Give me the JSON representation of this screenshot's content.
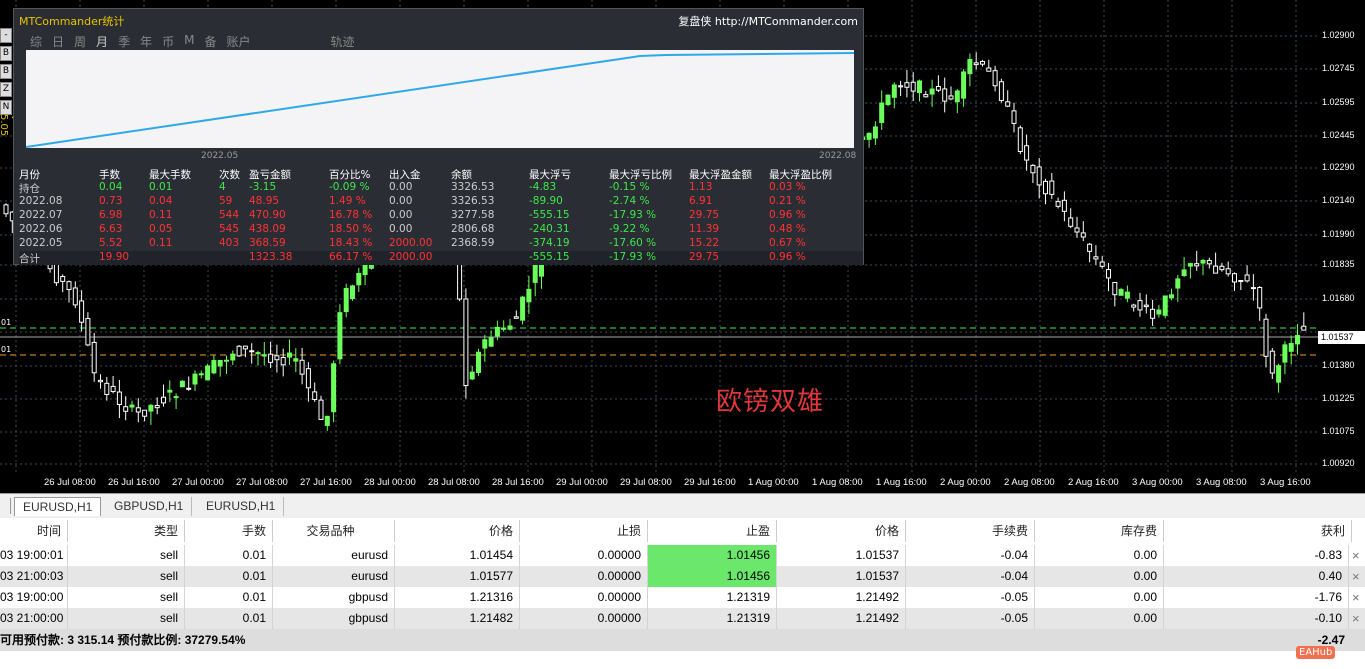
{
  "left_tools": [
    "-",
    "B",
    "B",
    "Z",
    "N"
  ],
  "version_label": "V 5.05",
  "left_levels": [
    "01",
    "01"
  ],
  "price_axis": {
    "labels": [
      "1.02900",
      "1.02745",
      "1.02595",
      "1.02445",
      "1.02290",
      "1.02140",
      "1.01990",
      "1.01835",
      "1.01680",
      "1.01380",
      "1.01225",
      "1.01075",
      "1.00920"
    ],
    "current": "1.01537"
  },
  "time_axis": [
    "26 Jul 08:00",
    "26 Jul 16:00",
    "27 Jul 00:00",
    "27 Jul 08:00",
    "27 Jul 16:00",
    "28 Jul 00:00",
    "28 Jul 08:00",
    "28 Jul 16:00",
    "29 Jul 00:00",
    "29 Jul 08:00",
    "29 Jul 16:00",
    "1 Aug 00:00",
    "1 Aug 08:00",
    "1 Aug 16:00",
    "2 Aug 00:00",
    "2 Aug 08:00",
    "2 Aug 16:00",
    "3 Aug 00:00",
    "3 Aug 08:00",
    "3 Aug 16:00"
  ],
  "watermark": "欧镑双雄",
  "stats": {
    "title": "MTCommander统计",
    "link": "复盘侠 http://MTCommander.com",
    "tabs": [
      "综",
      "日",
      "周",
      "月",
      "季",
      "年",
      "币",
      "M",
      "备",
      "账户",
      "轨迹"
    ],
    "active_tab": "月",
    "chart_start": "2022.05",
    "chart_end": "2022.08",
    "headers": [
      "月份",
      "手数",
      "最大手数",
      "次数",
      "盈亏金额",
      "百分比%",
      "出入金",
      "余额",
      "最大浮亏",
      "最大浮亏比例",
      "最大浮盈金额",
      "最大浮盈比例"
    ],
    "rows": [
      {
        "label": "持仓",
        "lots": "0.04",
        "max_lots": "0.01",
        "count": "4",
        "pnl": "-3.15",
        "pct": "-0.09 %",
        "io": "0.00",
        "balance": "3326.53",
        "max_dd": "-4.83",
        "max_dd_pct": "-0.15 %",
        "max_fp": "1.13",
        "max_fp_pct": "0.03 %"
      },
      {
        "label": "2022.08",
        "lots": "0.73",
        "max_lots": "0.04",
        "count": "59",
        "pnl": "48.95",
        "pct": "1.49 %",
        "io": "0.00",
        "balance": "3326.53",
        "max_dd": "-89.90",
        "max_dd_pct": "-2.74 %",
        "max_fp": "6.91",
        "max_fp_pct": "0.21 %"
      },
      {
        "label": "2022.07",
        "lots": "6.98",
        "max_lots": "0.11",
        "count": "544",
        "pnl": "470.90",
        "pct": "16.78 %",
        "io": "0.00",
        "balance": "3277.58",
        "max_dd": "-555.15",
        "max_dd_pct": "-17.93 %",
        "max_fp": "29.75",
        "max_fp_pct": "0.96 %"
      },
      {
        "label": "2022.06",
        "lots": "6.63",
        "max_lots": "0.05",
        "count": "545",
        "pnl": "438.09",
        "pct": "18.50 %",
        "io": "0.00",
        "balance": "2806.68",
        "max_dd": "-240.31",
        "max_dd_pct": "-9.22 %",
        "max_fp": "11.39",
        "max_fp_pct": "0.48 %"
      },
      {
        "label": "2022.05",
        "lots": "5.52",
        "max_lots": "0.11",
        "count": "403",
        "pnl": "368.59",
        "pct": "18.43 %",
        "io": "2000.00",
        "balance": "2368.59",
        "max_dd": "-374.19",
        "max_dd_pct": "-17.60 %",
        "max_fp": "15.22",
        "max_fp_pct": "0.67 %"
      }
    ],
    "total": {
      "label": "合计",
      "lots": "19.90",
      "max_lots": "",
      "count": "",
      "pnl": "1323.38",
      "pct": "66.17 %",
      "io": "2000.00",
      "balance": "",
      "max_dd": "-555.15",
      "max_dd_pct": "-17.93 %",
      "max_fp": "29.75",
      "max_fp_pct": "0.96 %"
    }
  },
  "chart_tabs": [
    "EURUSD,H1",
    "GBPUSD,H1",
    "EURUSD,H1"
  ],
  "active_chart_tab": 0,
  "terminal": {
    "headers": [
      "时间",
      "类型",
      "手数",
      "交易品种",
      "价格",
      "止损",
      "止盈",
      "价格",
      "手续费",
      "库存费",
      "获利"
    ],
    "rows": [
      {
        "time": "03 19:00:01",
        "type": "sell",
        "lots": "0.01",
        "symbol": "eurusd",
        "open": "1.01454",
        "sl": "0.00000",
        "tp": "1.01456",
        "price": "1.01537",
        "comm": "-0.04",
        "swap": "0.00",
        "profit": "-0.83",
        "tp_hit": true
      },
      {
        "time": "03 21:00:03",
        "type": "sell",
        "lots": "0.01",
        "symbol": "eurusd",
        "open": "1.01577",
        "sl": "0.00000",
        "tp": "1.01456",
        "price": "1.01537",
        "comm": "-0.04",
        "swap": "0.00",
        "profit": "0.40",
        "tp_hit": true
      },
      {
        "time": "03 19:00:00",
        "type": "sell",
        "lots": "0.01",
        "symbol": "gbpusd",
        "open": "1.21316",
        "sl": "0.00000",
        "tp": "1.21319",
        "price": "1.21492",
        "comm": "-0.05",
        "swap": "0.00",
        "profit": "-1.76",
        "tp_hit": false
      },
      {
        "time": "03 21:00:00",
        "type": "sell",
        "lots": "0.01",
        "symbol": "gbpusd",
        "open": "1.21482",
        "sl": "0.00000",
        "tp": "1.21319",
        "price": "1.21492",
        "comm": "-0.05",
        "swap": "0.00",
        "profit": "-0.10",
        "tp_hit": false
      }
    ],
    "footer_left": "可用预付款: 3 315.14  预付款比例: 37279.54%",
    "footer_right": "-2.47",
    "close_glyph": "×"
  },
  "badge": "EAHub",
  "colors": {
    "bull": "#6aff5a",
    "bear": "#ffffff",
    "grid": "#3a4a5a",
    "tp_fill": "#6be86b",
    "equity_line": "#2fa8e8",
    "watermark": "#e0383a"
  }
}
